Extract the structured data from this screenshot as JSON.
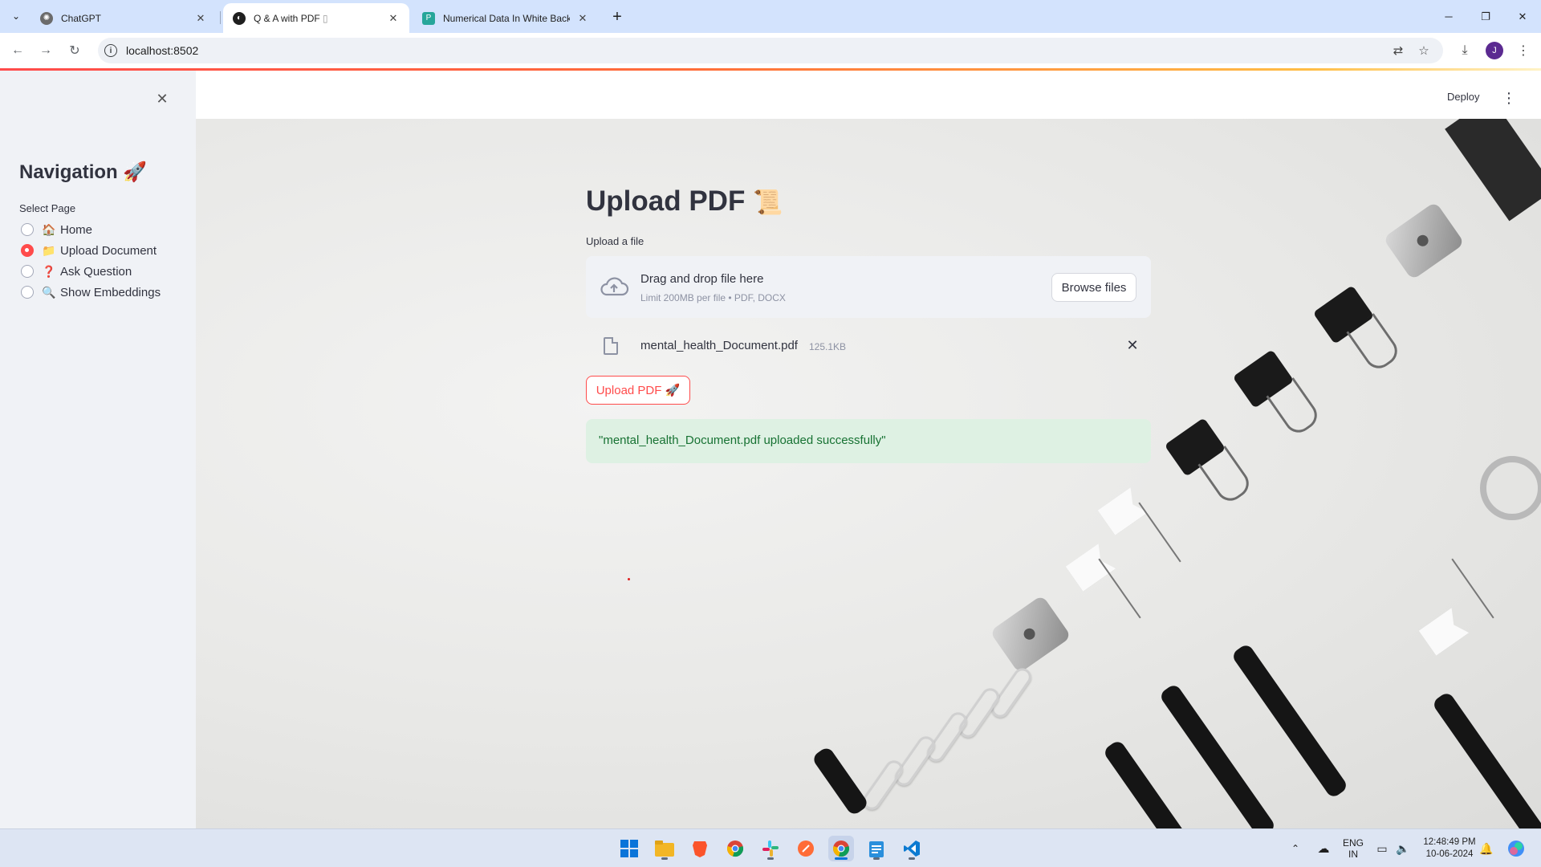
{
  "browser": {
    "tabs": [
      {
        "label": "ChatGPT",
        "icon": "chatgpt-icon"
      },
      {
        "label": "Q & A with PDF",
        "icon": "streamlit-icon"
      },
      {
        "label": "Numerical Data In White Backg",
        "icon": "doc-icon"
      }
    ],
    "url": "localhost:8502"
  },
  "sidebar": {
    "title": "Navigation 🚀",
    "select_label": "Select Page",
    "items": [
      {
        "emoji": "🏠",
        "label": "Home",
        "selected": false
      },
      {
        "emoji": "📁",
        "label": "Upload Document",
        "selected": true
      },
      {
        "emoji": "❓",
        "label": "Ask Question",
        "selected": false
      },
      {
        "emoji": "🔍",
        "label": "Show Embeddings",
        "selected": false
      }
    ]
  },
  "header": {
    "deploy_label": "Deploy"
  },
  "main": {
    "title": "Upload PDF",
    "title_emoji": "📜",
    "uploader_label": "Upload a file",
    "dropzone_title": "Drag and drop file here",
    "dropzone_limit": "Limit 200MB per file • PDF, DOCX",
    "browse_label": "Browse files",
    "file": {
      "name": "mental_health_Document.pdf",
      "size": "125.1KB"
    },
    "upload_button": "Upload PDF 🚀",
    "success_message": "\"mental_health_Document.pdf uploaded successfully\""
  },
  "taskbar": {
    "lang_line1": "ENG",
    "lang_line2": "IN",
    "time": "12:48:49 PM",
    "date": "10-06-2024"
  },
  "colors": {
    "accent": "#ff4b4b",
    "success_bg": "#dcf1e2",
    "success_text": "#177233",
    "sidebar_bg": "#f0f2f6"
  }
}
